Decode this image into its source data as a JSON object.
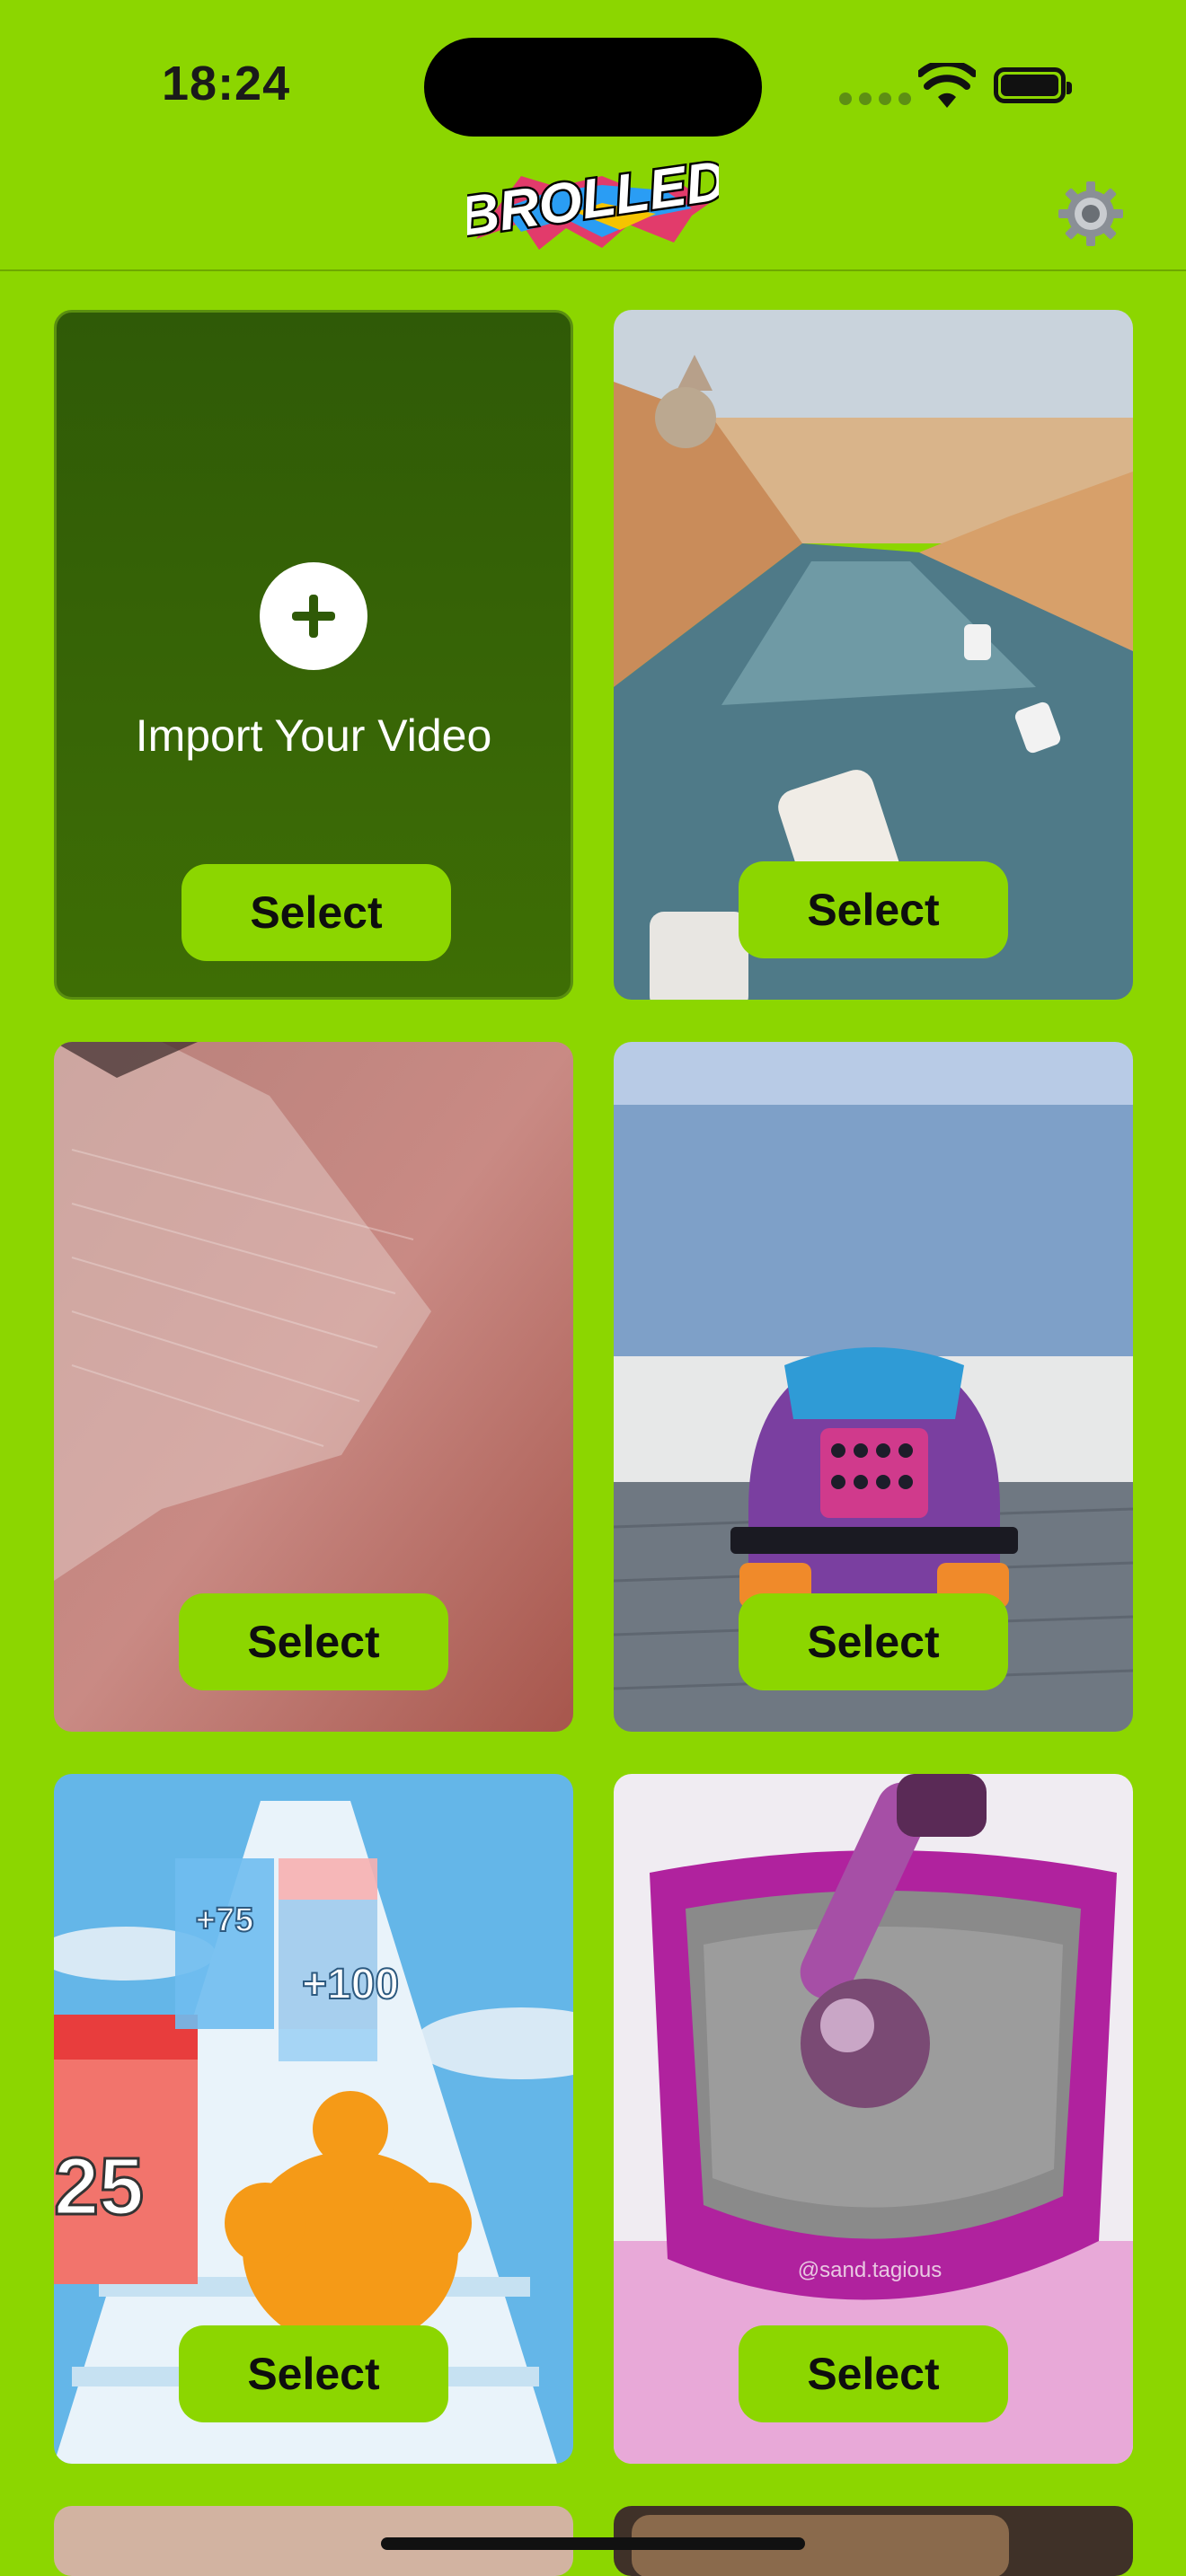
{
  "status": {
    "time": "18:24"
  },
  "header": {
    "logo_text": "BROLLED"
  },
  "import": {
    "label": "Import Your Video",
    "button": "Select"
  },
  "cards": [
    {
      "name": "venice-canal",
      "button": "Select"
    },
    {
      "name": "skin-closeup",
      "button": "Select"
    },
    {
      "name": "toy-car",
      "button": "Select"
    },
    {
      "name": "runner-game",
      "button": "Select",
      "overlay_texts": [
        "+75",
        "+100",
        "25"
      ]
    },
    {
      "name": "kinetic-sand",
      "button": "Select",
      "watermark": "@sand.tagious"
    }
  ],
  "colors": {
    "background": "#8cd600",
    "import_card": "#3a6606",
    "button": "#8cd600"
  }
}
